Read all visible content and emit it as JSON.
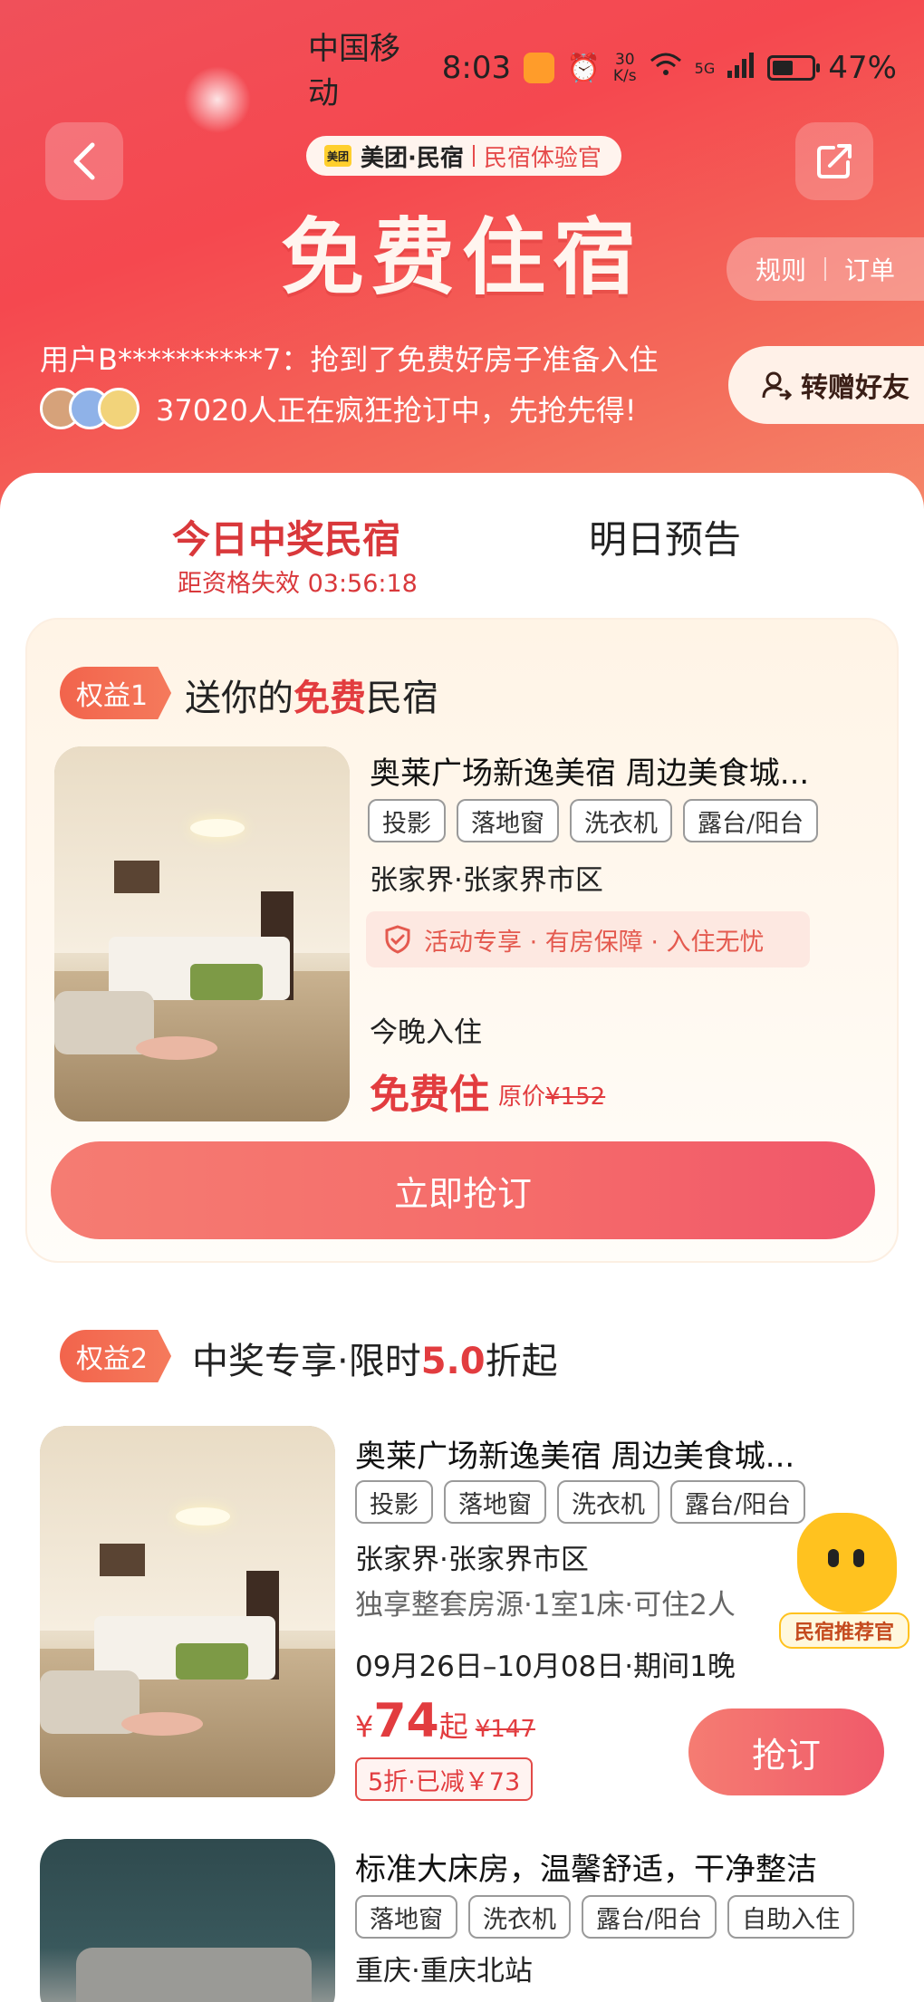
{
  "status_bar": {
    "carrier": "中国移动",
    "time": "8:03",
    "net_speed_value": "30",
    "net_speed_unit": "K/s",
    "signal_label": "5G",
    "battery": "47%"
  },
  "header": {
    "brand_name": "美团·民宿",
    "brand_logo_text": "美团",
    "brand_sub": "民宿体验官",
    "title": "免费住宿",
    "rules_label": "规则",
    "orders_label": "订单",
    "ticker_text": "用户B**********7：抢到了免费好房子准备入住",
    "online_text": "37020人正在疯狂抢订中，先抢先得!",
    "gift_button": "转赠好友"
  },
  "tabs": {
    "today": "今日中奖民宿",
    "today_countdown": "距资格失效 03:56:18",
    "tomorrow": "明日预告"
  },
  "perk1": {
    "tag": "权益1",
    "title_pre": "送你的",
    "title_hl": "免费",
    "title_post": "民宿",
    "hotel_name": "奥莱广场新逸美宿 周边美食城...",
    "tags": [
      "投影",
      "落地窗",
      "洗衣机",
      "露台/阳台"
    ],
    "location": "张家界·张家界市区",
    "guarantee": "活动专享 · 有房保障 · 入住无忧",
    "checkin": "今晚入住",
    "price": "免费住",
    "orig_label": "原价",
    "orig_price": "¥152",
    "button": "立即抢订"
  },
  "perk2": {
    "tag": "权益2",
    "title_pre": "中奖专享·限时",
    "title_hl": "5.0",
    "title_post": "折起",
    "hotel_name": "奥莱广场新逸美宿 周边美食城...",
    "tags": [
      "投影",
      "落地窗",
      "洗衣机",
      "露台/阳台"
    ],
    "location": "张家界·张家界市区",
    "room_info": "独享整套房源·1室1床·可住2人",
    "dates": "09月26日–10月08日·期间1晚",
    "price_symbol": "¥",
    "price": "74",
    "price_suffix": "起",
    "was_price": "¥147",
    "discount": "5折·已减￥73",
    "button": "抢订",
    "mascot_label": "民宿推荐官"
  },
  "listing3": {
    "hotel_name": "标准大床房，温馨舒适，干净整洁",
    "tags": [
      "落地窗",
      "洗衣机",
      "露台/阳台",
      "自助入住"
    ],
    "location": "重庆·重庆北站"
  },
  "colors": {
    "brand_red": "#e23c3f",
    "hero_gradient_start": "#f0505a",
    "button_gradient": "#f56b6a"
  }
}
